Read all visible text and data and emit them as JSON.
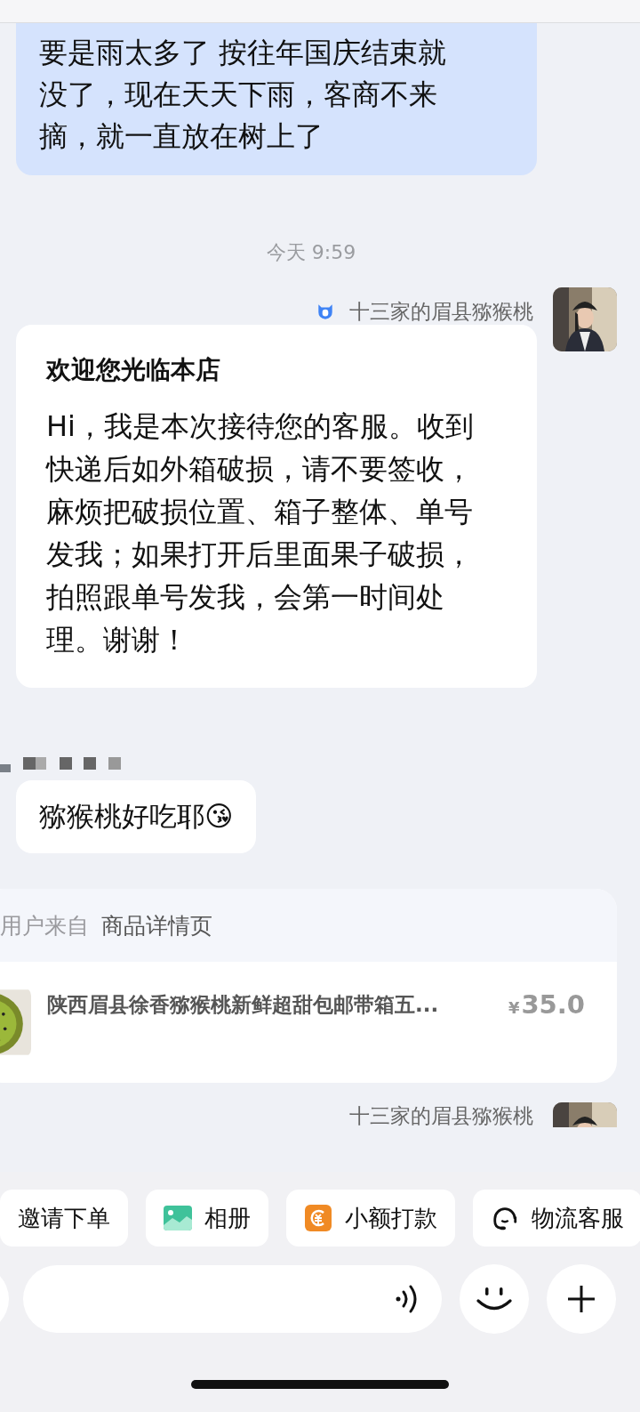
{
  "messages": [
    {
      "kind": "outgoing",
      "lines": [
        "要是雨太多了  按往年国庆结束就",
        "没了，现在天天下雨，客商不来",
        "摘，就一直放在树上了"
      ]
    },
    {
      "kind": "time",
      "text": "今天 9:59"
    },
    {
      "kind": "sender",
      "name": "十三家的眉县猕猴桃",
      "badge": true
    },
    {
      "kind": "card",
      "title": "欢迎您光临本店",
      "body": "Hi，我是本次接待您的客服。收到快递后如外箱破损，请不要签收，麻烦把破损位置、箱子整体、单号发我；如果打开后里面果子破损，拍照跟单号发我，会第一时间处理。谢谢！"
    },
    {
      "kind": "blurred-name"
    },
    {
      "kind": "incoming",
      "text": "猕猴桃好吃耶😘"
    },
    {
      "kind": "product",
      "source_label": "用户来自",
      "source": "商品详情页",
      "title": "陕西眉县徐香猕猴桃新鲜超甜包邮带箱五...",
      "price_symbol": "¥",
      "price": "35.0"
    },
    {
      "kind": "sender",
      "name": "十三家的眉县猕猴桃",
      "badge": false
    }
  ],
  "quick_actions": [
    {
      "kind": "none",
      "label": "邀请下单"
    },
    {
      "kind": "album",
      "label": "相册"
    },
    {
      "kind": "payment",
      "label": "小额打款"
    },
    {
      "kind": "headset",
      "label": "物流客服"
    }
  ]
}
